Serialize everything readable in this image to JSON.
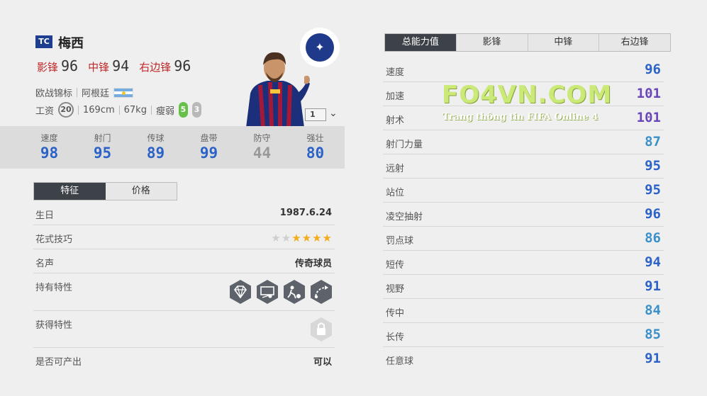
{
  "player": {
    "season_badge": "TC",
    "name": "梅西",
    "positions": [
      {
        "label": "影锋",
        "value": "96"
      },
      {
        "label": "中锋",
        "value": "94"
      },
      {
        "label": "右边锋",
        "value": "96"
      }
    ],
    "league": "欧战锦标",
    "nation": "阿根廷",
    "wage_label": "工资",
    "wage": "20",
    "height": "169cm",
    "weight": "67kg",
    "body_type": "瘦弱",
    "weak_foot": "5",
    "skill_moves": "3",
    "level": "1"
  },
  "main_stats": [
    {
      "label": "速度",
      "value": "98",
      "color": "blue"
    },
    {
      "label": "射门",
      "value": "95",
      "color": "blue"
    },
    {
      "label": "传球",
      "value": "89",
      "color": "blue"
    },
    {
      "label": "盘带",
      "value": "99",
      "color": "blue"
    },
    {
      "label": "防守",
      "value": "44",
      "color": "gray"
    },
    {
      "label": "强壮",
      "value": "80",
      "color": "blue"
    }
  ],
  "left_tabs": [
    "特征",
    "价格"
  ],
  "info": {
    "birthday_label": "生日",
    "birthday": "1987.6.24",
    "skill_label": "花式技巧",
    "skill_stars": 4,
    "skill_stars_max": 6,
    "fame_label": "名声",
    "fame": "传奇球员",
    "traits_label": "持有特性",
    "trait_icons": [
      "diamond-trait-icon",
      "goal-trait-icon",
      "dribble-trait-icon",
      "pass-trait-icon"
    ],
    "acquired_label": "获得特性",
    "tradable_label": "是否可产出",
    "tradable": "可以"
  },
  "right_tabs": [
    "总能力值",
    "影锋",
    "中锋",
    "右边锋"
  ],
  "attributes": [
    {
      "name": "速度",
      "value": "96",
      "color": "blue"
    },
    {
      "name": "加速",
      "value": "101",
      "color": "purple"
    },
    {
      "name": "射术",
      "value": "101",
      "color": "purple"
    },
    {
      "name": "射门力量",
      "value": "87",
      "color": "teal"
    },
    {
      "name": "远射",
      "value": "95",
      "color": "blue"
    },
    {
      "name": "站位",
      "value": "95",
      "color": "blue"
    },
    {
      "name": "凌空抽射",
      "value": "96",
      "color": "blue"
    },
    {
      "name": "罚点球",
      "value": "86",
      "color": "teal"
    },
    {
      "name": "短传",
      "value": "94",
      "color": "blue"
    },
    {
      "name": "视野",
      "value": "91",
      "color": "blue"
    },
    {
      "name": "传中",
      "value": "84",
      "color": "teal"
    },
    {
      "name": "长传",
      "value": "85",
      "color": "teal"
    },
    {
      "name": "任意球",
      "value": "91",
      "color": "blue"
    }
  ],
  "watermark": {
    "main": "FO4VN.COM",
    "sub": "Trang thông tin FIFA Online 4"
  },
  "colors": {
    "accent_red": "#c0292b",
    "stat_blue": "#2b62c8",
    "stat_purple": "#6a47b8",
    "stat_teal": "#3a90c8",
    "tab_active": "#3d4148"
  }
}
